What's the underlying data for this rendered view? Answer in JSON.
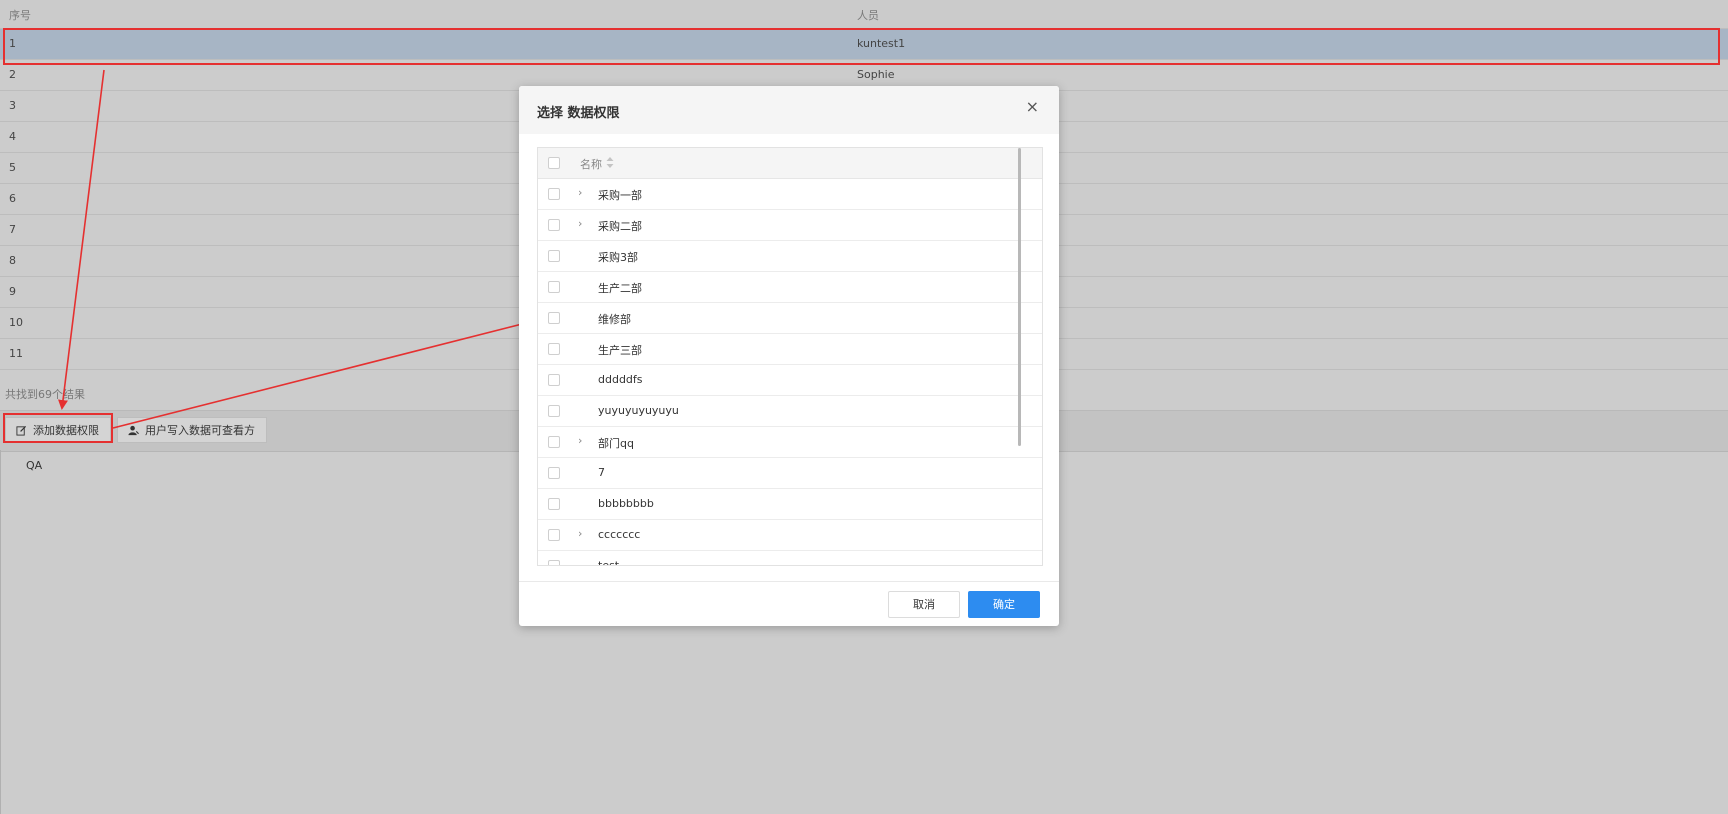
{
  "table": {
    "headers": [
      "序号",
      "人员"
    ],
    "rows": [
      {
        "index": "1",
        "person": "kuntest1"
      },
      {
        "index": "2",
        "person": "Sophie"
      },
      {
        "index": "3",
        "person": ""
      },
      {
        "index": "4",
        "person": ""
      },
      {
        "index": "5",
        "person": ""
      },
      {
        "index": "6",
        "person": ""
      },
      {
        "index": "7",
        "person": ""
      },
      {
        "index": "8",
        "person": ""
      },
      {
        "index": "9",
        "person": ""
      },
      {
        "index": "10",
        "person": ""
      },
      {
        "index": "11",
        "person": ""
      }
    ],
    "result_count": "共找到69个结果"
  },
  "toolbar": {
    "add_permission_label": "添加数据权限",
    "user_write_label": "用户写入数据可查看方"
  },
  "qa_label": "QA",
  "modal": {
    "title": "选择 数据权限",
    "close_symbol": "×",
    "column_header": "名称",
    "rows": [
      {
        "label": "采购一部",
        "expandable": true
      },
      {
        "label": "采购二部",
        "expandable": true
      },
      {
        "label": "采购3部",
        "expandable": false
      },
      {
        "label": "生产二部",
        "expandable": false
      },
      {
        "label": "维修部",
        "expandable": false
      },
      {
        "label": "生产三部",
        "expandable": false
      },
      {
        "label": "dddddfs",
        "expandable": false
      },
      {
        "label": "yuyuyuyuyuyu",
        "expandable": false
      },
      {
        "label": "部门qq",
        "expandable": true
      },
      {
        "label": "7",
        "expandable": false
      },
      {
        "label": "bbbbbbbb",
        "expandable": false
      },
      {
        "label": "ccccccc",
        "expandable": true
      },
      {
        "label": "test",
        "expandable": false
      }
    ],
    "cancel_label": "取消",
    "ok_label": "确定"
  },
  "colors": {
    "accent": "#2d8cf0",
    "annotation": "#e53030",
    "selected_row": "#a7b5c5"
  }
}
